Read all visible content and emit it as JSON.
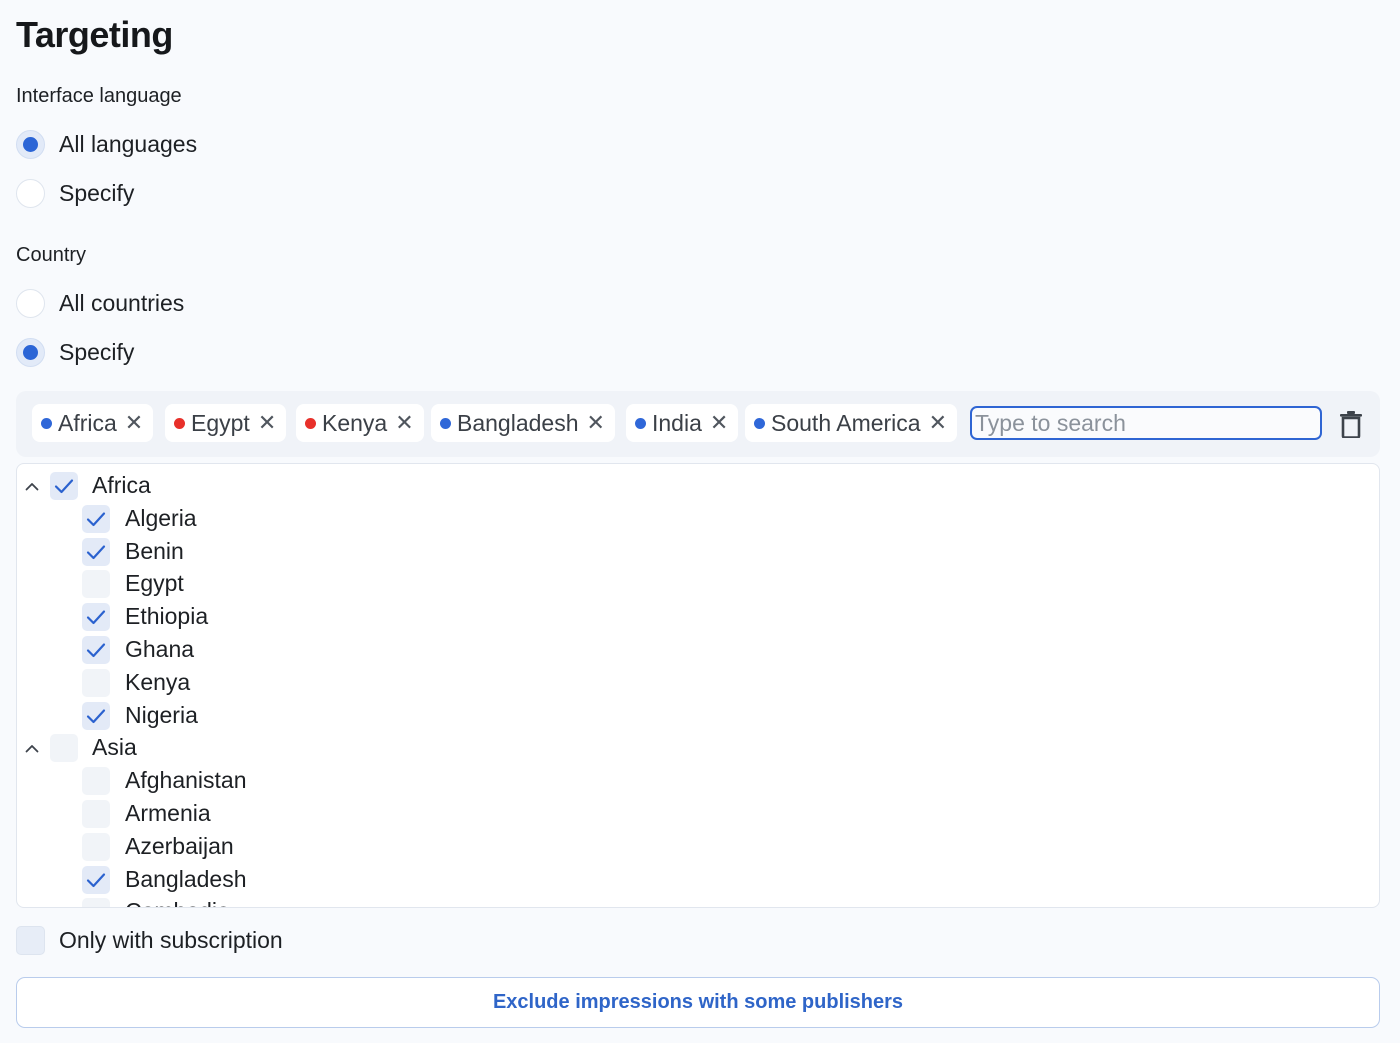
{
  "page_title": "Targeting",
  "interface_language": {
    "label": "Interface language",
    "options": [
      {
        "label": "All languages",
        "checked": true
      },
      {
        "label": "Specify",
        "checked": false
      }
    ]
  },
  "country": {
    "label": "Country",
    "options": [
      {
        "label": "All countries",
        "checked": false
      },
      {
        "label": "Specify",
        "checked": true
      }
    ]
  },
  "colors": {
    "accent": "#2b65d6",
    "included_dot": "#2f67d8",
    "excluded_dot": "#e8302a"
  },
  "selected_tags": [
    {
      "label": "Africa",
      "status": "included",
      "remove": "✕"
    },
    {
      "label": "Egypt",
      "status": "excluded",
      "remove": "✕"
    },
    {
      "label": "Kenya",
      "status": "excluded",
      "remove": "✕"
    },
    {
      "label": "Bangladesh",
      "status": "included",
      "remove": "✕"
    },
    {
      "label": "India",
      "status": "included",
      "remove": "✕"
    },
    {
      "label": "South America",
      "status": "included",
      "remove": "✕"
    }
  ],
  "search": {
    "placeholder": "Type to search",
    "value": ""
  },
  "clear_icon": "trash-icon",
  "tree": [
    {
      "label": "Africa",
      "level": 0,
      "checked": true,
      "expanded": true
    },
    {
      "label": "Algeria",
      "level": 1,
      "checked": true
    },
    {
      "label": "Benin",
      "level": 1,
      "checked": true
    },
    {
      "label": "Egypt",
      "level": 1,
      "checked": false
    },
    {
      "label": "Ethiopia",
      "level": 1,
      "checked": true
    },
    {
      "label": "Ghana",
      "level": 1,
      "checked": true
    },
    {
      "label": "Kenya",
      "level": 1,
      "checked": false
    },
    {
      "label": "Nigeria",
      "level": 1,
      "checked": true
    },
    {
      "label": "Asia",
      "level": 0,
      "checked": false,
      "expanded": true
    },
    {
      "label": "Afghanistan",
      "level": 1,
      "checked": false
    },
    {
      "label": "Armenia",
      "level": 1,
      "checked": false
    },
    {
      "label": "Azerbaijan",
      "level": 1,
      "checked": false
    },
    {
      "label": "Bangladesh",
      "level": 1,
      "checked": true
    },
    {
      "label": "Cambodia",
      "level": 1,
      "checked": false
    }
  ],
  "subscription": {
    "label": "Only with subscription",
    "checked": false
  },
  "exclude_button": {
    "label": "Exclude impressions with some publishers"
  }
}
